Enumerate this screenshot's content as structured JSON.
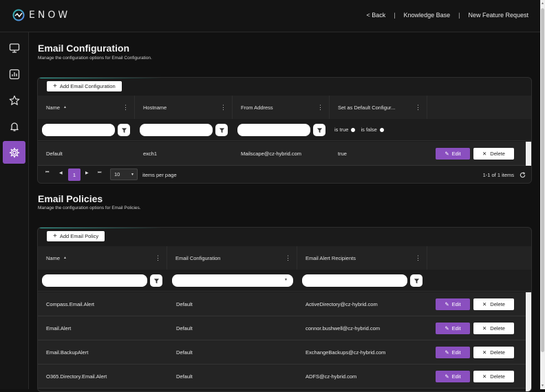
{
  "app": {
    "logo_text": "ENOW"
  },
  "topnav": {
    "back": "< Back",
    "knowledge_base": "Knowledge Base",
    "feature_request": "New Feature Request",
    "separator": "|"
  },
  "sidebar": {
    "items": [
      {
        "icon": "monitor-icon"
      },
      {
        "icon": "chart-icon"
      },
      {
        "icon": "star-icon"
      },
      {
        "icon": "bell-icon"
      },
      {
        "icon": "gear-icon",
        "active": true
      }
    ],
    "accent_color": "#8a4fbf"
  },
  "email_config": {
    "title": "Email Configuration",
    "subtitle": "Manage the configuration options for Email Configuration.",
    "add_label": "Add Email Configuration",
    "columns": [
      "Name",
      "Hostname",
      "From Address",
      "Set as Default Configur..."
    ],
    "bool_filter": {
      "true_label": "is true",
      "false_label": "is false"
    },
    "rows": [
      {
        "name": "Default",
        "hostname": "exch1",
        "from": "Mailscape@cz-hybrid.com",
        "is_default": "true"
      }
    ],
    "pager": {
      "page": "1",
      "page_size": "10",
      "items_per_page": "items per page",
      "range": "1-1 of 1 items"
    }
  },
  "email_policies": {
    "title": "Email Policies",
    "subtitle": "Manage the configuration options for Email Policies.",
    "add_label": "Add Email Policy",
    "columns": [
      "Name",
      "Email Configuration",
      "Email Alert Recipients"
    ],
    "rows": [
      {
        "name": "Compass.Email.Alert",
        "config": "Default",
        "recipients": "ActiveDirectory@cz-hybrid.com"
      },
      {
        "name": "Email.Alert",
        "config": "Default",
        "recipients": "connor.bushwell@cz-hybrid.com"
      },
      {
        "name": "Email.BackupAlert",
        "config": "Default",
        "recipients": "ExchangeBackups@cz-hybrid.com"
      },
      {
        "name": "O365.Directory.Email.Alert",
        "config": "Default",
        "recipients": "ADFS@cz-hybrid.com"
      }
    ]
  },
  "actions": {
    "edit": "Edit",
    "delete": "Delete"
  }
}
